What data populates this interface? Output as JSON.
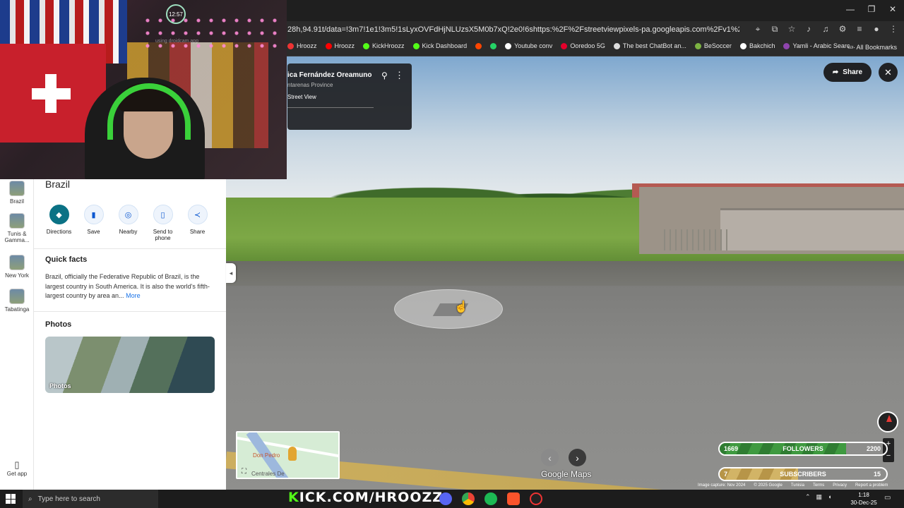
{
  "browser": {
    "url": "28h,94.91t/data=!3m7!1e1!3m5!1sLyxOVFdHjNLUzsX5M0b7xQ!2e0!6shttps:%2F%2Fstreetviewpixels-pa.googleapis.com%2Fv1%2Fthumbnail%3Fcb_client...",
    "bookmarks": [
      "Hroozz",
      "Hroozz",
      "KickHroozz",
      "Kick Dashboard",
      "",
      "",
      "Youtube conv",
      "Ooredoo 5G",
      "The best ChatBot an...",
      "BeSoccer",
      "Bakchich",
      "Yamli - Arabic Searc..."
    ],
    "all_bookmarks": "All Bookmarks"
  },
  "streetview": {
    "card_title": "ica Fernández Oreamuno",
    "card_subtitle": "ntarenas Province",
    "card_link": "Street View",
    "share_label": "Share",
    "brand": "Google Maps",
    "minimap_label1": "Don Pedro",
    "minimap_label2": "Centrales De",
    "attribution": [
      "Image capture: Nov 2024",
      "© 2025 Google",
      "Tunisia",
      "Terms",
      "Privacy",
      "Report a problem"
    ]
  },
  "overlay": {
    "followers": {
      "current": "1669",
      "label": "FOLLOWERS",
      "goal": "2200",
      "progress": 0.76
    },
    "subscribers": {
      "current": "7",
      "label": "SUBSCRIBERS",
      "goal": "15",
      "progress": 0.47
    },
    "webcam_watermark": "using droidcam.app",
    "clock": "12:57",
    "kick_banner_k": "K",
    "kick_banner_rest": "ICK.COM/HROOZZ"
  },
  "sidebar": {
    "items": [
      {
        "label": "Brazil"
      },
      {
        "label": "Tunis & Gamma..."
      },
      {
        "label": "New York"
      },
      {
        "label": "Tabatinga"
      }
    ],
    "get_app": "Get app"
  },
  "panel": {
    "title": "Brazil",
    "actions": [
      "Directions",
      "Save",
      "Nearby",
      "Send to phone",
      "Share"
    ],
    "quick_facts_title": "Quick facts",
    "quick_facts_text": "Brazil, officially the Federative Republic of Brazil, is the largest country in South America. It is also the world's fifth-largest country by area an...",
    "more": "More",
    "photos_title": "Photos",
    "photo_label": "Photos"
  },
  "taskbar": {
    "search_placeholder": "Type here to search",
    "time": "1:18",
    "date": "30-Dec-25"
  },
  "colors": {
    "followers_fill": "#3b8f3b",
    "subscribers_fill": "#c8a85a",
    "kick_green": "#53fc18"
  }
}
